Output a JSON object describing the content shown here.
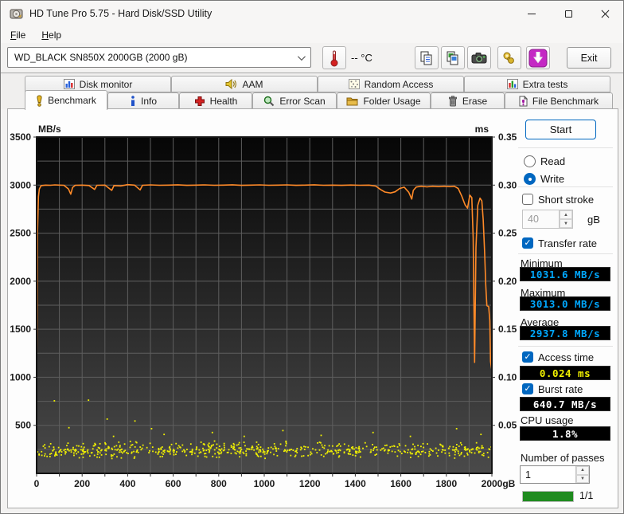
{
  "window": {
    "title": "HD Tune Pro 5.75 - Hard Disk/SSD Utility"
  },
  "menu": {
    "file": "File",
    "help": "Help"
  },
  "toolbar": {
    "drive_select_value": "WD_BLACK SN850X 2000GB (2000 gB)",
    "temperature": "-- °C",
    "exit_label": "Exit"
  },
  "tabs": {
    "row1": [
      {
        "label": "Disk monitor"
      },
      {
        "label": "AAM"
      },
      {
        "label": "Random Access"
      },
      {
        "label": "Extra tests"
      }
    ],
    "row2": [
      {
        "label": "Benchmark",
        "active": true
      },
      {
        "label": "Info"
      },
      {
        "label": "Health"
      },
      {
        "label": "Error Scan"
      },
      {
        "label": "Folder Usage"
      },
      {
        "label": "Erase"
      },
      {
        "label": "File Benchmark"
      }
    ]
  },
  "panel": {
    "start_label": "Start",
    "read_label": "Read",
    "write_label": "Write",
    "read_selected": false,
    "write_selected": true,
    "short_stroke_label": "Short stroke",
    "short_stroke_checked": false,
    "short_stroke_value": "40",
    "short_stroke_unit": "gB",
    "transfer_rate_label": "Transfer rate",
    "transfer_rate_checked": true,
    "minimum_label": "Minimum",
    "minimum_value": "1031.6 MB/s",
    "maximum_label": "Maximum",
    "maximum_value": "3013.0 MB/s",
    "average_label": "Average",
    "average_value": "2937.8 MB/s",
    "access_time_label": "Access time",
    "access_time_checked": true,
    "access_time_value": "0.024 ms",
    "burst_rate_label": "Burst rate",
    "burst_rate_checked": true,
    "burst_rate_value": "640.7 MB/s",
    "cpu_usage_label": "CPU usage",
    "cpu_usage_value": "1.8%",
    "passes_label": "Number of passes",
    "passes_value": "1",
    "progress_text": "1/1",
    "progress_percent": 100
  },
  "icons": {
    "spin_up": "▲",
    "spin_down": "▼"
  },
  "chart_data": {
    "type": "line",
    "title": "Benchmark transfer rate (write) with access time scatter",
    "x_axis": {
      "unit": "gB",
      "range": [
        0,
        2000
      ],
      "tick_step": 200,
      "minor_tick_step": 100,
      "tick_labels": [
        "0",
        "200",
        "400",
        "600",
        "800",
        "1000",
        "1200",
        "1400",
        "1600",
        "1800",
        "2000gB"
      ]
    },
    "y_left_axis": {
      "label": "MB/s",
      "range": [
        0,
        3500
      ],
      "tick_step": 500,
      "grid_step": 250,
      "tick_labels": [
        "3500",
        "3000",
        "2500",
        "2000",
        "1500",
        "1000",
        "500"
      ]
    },
    "y_right_axis": {
      "label": "ms",
      "range": [
        0,
        0.35
      ],
      "tick_step": 0.05,
      "tick_labels": [
        "0.35",
        "0.30",
        "0.25",
        "0.20",
        "0.15",
        "0.10",
        "0.05"
      ]
    },
    "grid": true,
    "colors": {
      "plot_bg_top": "#060606",
      "plot_bg_bottom": "#4a4a4a",
      "grid": "#5e5e5e",
      "axis_text": "#1a1a1a",
      "transfer_line": "#ff8a28",
      "access_dots": "#f2f200"
    },
    "series": [
      {
        "name": "Transfer rate (Write)",
        "type": "line",
        "axis": "left",
        "unit": "MB/s",
        "color": "#ff8a28",
        "points": [
          [
            0,
            1031
          ],
          [
            2,
            1600
          ],
          [
            4,
            2500
          ],
          [
            8,
            2880
          ],
          [
            12,
            2960
          ],
          [
            20,
            2995
          ],
          [
            40,
            3000
          ],
          [
            60,
            2998
          ],
          [
            80,
            3002
          ],
          [
            100,
            3000
          ],
          [
            120,
            2998
          ],
          [
            140,
            2960
          ],
          [
            150,
            2905
          ],
          [
            158,
            2975
          ],
          [
            170,
            2998
          ],
          [
            200,
            3000
          ],
          [
            230,
            2996
          ],
          [
            255,
            2955
          ],
          [
            265,
            2998
          ],
          [
            300,
            3000
          ],
          [
            330,
            2945
          ],
          [
            340,
            2995
          ],
          [
            370,
            2992
          ],
          [
            400,
            3005
          ],
          [
            430,
            3000
          ],
          [
            455,
            2950
          ],
          [
            465,
            2998
          ],
          [
            500,
            3002
          ],
          [
            540,
            2998
          ],
          [
            580,
            3000
          ],
          [
            620,
            3003
          ],
          [
            660,
            2997
          ],
          [
            700,
            3000
          ],
          [
            740,
            3002
          ],
          [
            780,
            2998
          ],
          [
            820,
            3000
          ],
          [
            860,
            3003
          ],
          [
            900,
            2997
          ],
          [
            940,
            3000
          ],
          [
            980,
            3002
          ],
          [
            1020,
            2998
          ],
          [
            1060,
            3000
          ],
          [
            1100,
            3002
          ],
          [
            1140,
            2997
          ],
          [
            1180,
            3000
          ],
          [
            1220,
            3003
          ],
          [
            1260,
            2998
          ],
          [
            1300,
            3000
          ],
          [
            1340,
            2997
          ],
          [
            1380,
            3001
          ],
          [
            1420,
            2998
          ],
          [
            1460,
            3000
          ],
          [
            1490,
            2990
          ],
          [
            1510,
            2955
          ],
          [
            1530,
            2928
          ],
          [
            1555,
            2918
          ],
          [
            1575,
            2930
          ],
          [
            1595,
            2965
          ],
          [
            1615,
            2978
          ],
          [
            1635,
            2925
          ],
          [
            1648,
            2855
          ],
          [
            1655,
            2945
          ],
          [
            1668,
            2980
          ],
          [
            1690,
            2988
          ],
          [
            1715,
            2982
          ],
          [
            1740,
            2988
          ],
          [
            1765,
            2984
          ],
          [
            1790,
            2988
          ],
          [
            1815,
            2984
          ],
          [
            1835,
            2988
          ],
          [
            1852,
            2965
          ],
          [
            1868,
            2885
          ],
          [
            1882,
            2795
          ],
          [
            1893,
            2760
          ],
          [
            1903,
            2895
          ],
          [
            1912,
            2870
          ],
          [
            1918,
            2450
          ],
          [
            1924,
            1155
          ],
          [
            1930,
            2350
          ],
          [
            1938,
            2790
          ],
          [
            1948,
            2865
          ],
          [
            1956,
            2835
          ],
          [
            1962,
            2640
          ],
          [
            1968,
            2320
          ],
          [
            1973,
            1960
          ],
          [
            1978,
            1745
          ],
          [
            1986,
            1735
          ],
          [
            1991,
            1590
          ],
          [
            1994,
            1165
          ],
          [
            1997,
            1120
          ],
          [
            2000,
            1075
          ]
        ]
      },
      {
        "name": "Access time",
        "type": "scatter",
        "axis": "right",
        "unit": "ms",
        "color": "#f2f200",
        "band": {
          "seed": 1337,
          "count": 620,
          "x_min": 2,
          "x_max": 1998,
          "ms_min": 0.015,
          "ms_max": 0.034
        },
        "outliers": [
          [
            78,
            0.0755
          ],
          [
            142,
            0.0475
          ],
          [
            228,
            0.0762
          ],
          [
            310,
            0.0565
          ],
          [
            338,
            0.0385
          ],
          [
            432,
            0.0545
          ],
          [
            505,
            0.0465
          ],
          [
            560,
            0.0405
          ],
          [
            772,
            0.0425
          ],
          [
            912,
            0.0385
          ],
          [
            1082,
            0.0445
          ],
          [
            1250,
            0.0395
          ],
          [
            1478,
            0.0425
          ],
          [
            1642,
            0.0385
          ],
          [
            1845,
            0.0465
          ],
          [
            1952,
            0.0405
          ]
        ]
      }
    ]
  }
}
